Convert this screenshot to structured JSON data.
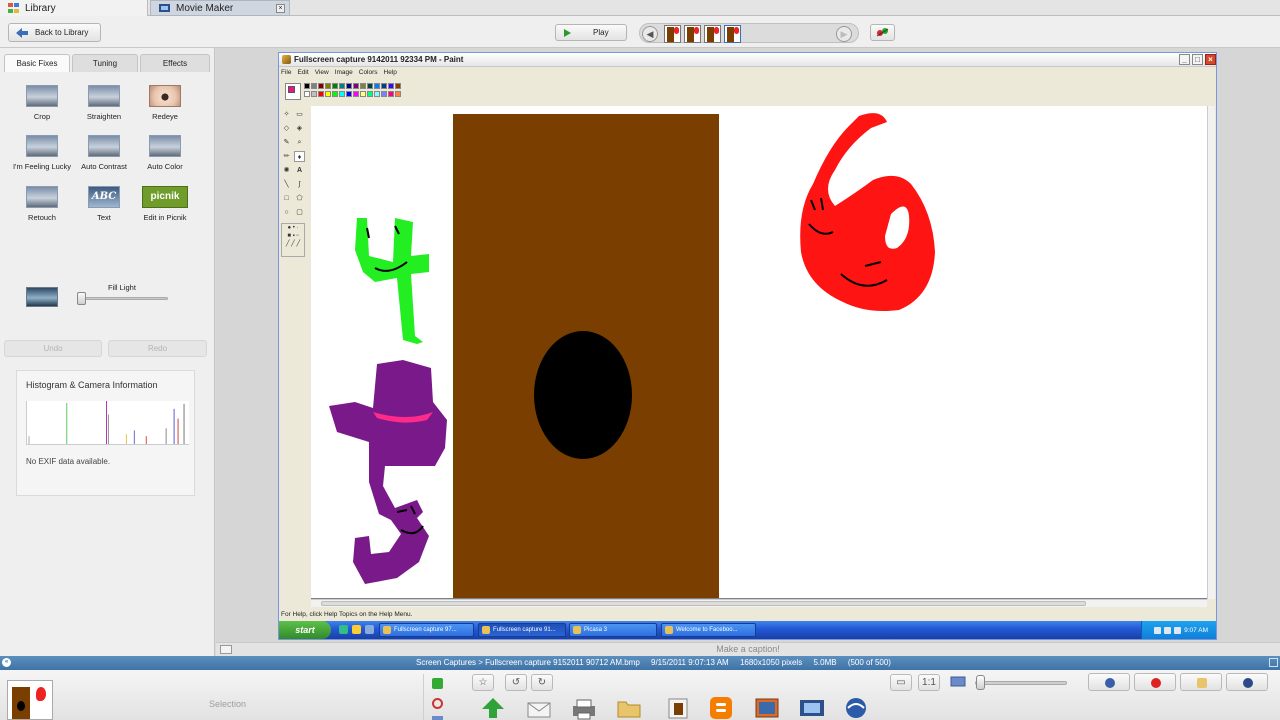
{
  "tabs": {
    "library": "Library",
    "movie_maker": "Movie Maker"
  },
  "toolbar": {
    "back_label": "Back to Library",
    "play_label": "Play"
  },
  "left_panel": {
    "tabs": [
      "Basic Fixes",
      "Tuning",
      "Effects"
    ],
    "fixes": [
      {
        "label": "Crop",
        "icon": "crop-icon"
      },
      {
        "label": "Straighten",
        "icon": "straighten-icon"
      },
      {
        "label": "Redeye",
        "icon": "redeye-icon"
      },
      {
        "label": "I'm Feeling Lucky",
        "icon": "feeling-lucky-icon"
      },
      {
        "label": "Auto Contrast",
        "icon": "auto-contrast-icon"
      },
      {
        "label": "Auto Color",
        "icon": "auto-color-icon"
      },
      {
        "label": "Retouch",
        "icon": "retouch-icon"
      },
      {
        "label": "Text",
        "icon": "text-icon"
      },
      {
        "label": "Edit in Picnik",
        "icon": "picnik-icon"
      }
    ],
    "fill_light_label": "Fill Light",
    "fill_light_value": 0,
    "undo_label": "Undo",
    "redo_label": "Redo",
    "histogram_title": "Histogram & Camera Information",
    "exif_text": "No EXIF data available.",
    "abc_glyph": "ABC",
    "picnik_glyph": "picnik"
  },
  "paint": {
    "title": "Fullscreen capture 9142011 92334 PM - Paint",
    "menus": [
      "File",
      "Edit",
      "View",
      "Image",
      "Colors",
      "Help"
    ],
    "status": "For Help, click Help Topics on the Help Menu.",
    "palette_colors": [
      "#000000",
      "#808080",
      "#800000",
      "#808000",
      "#008000",
      "#008080",
      "#000080",
      "#800080",
      "#808040",
      "#004040",
      "#0080ff",
      "#004080",
      "#4000ff",
      "#804000",
      "#ffffff",
      "#c0c0c0",
      "#ff0000",
      "#ffff00",
      "#00ff00",
      "#00ffff",
      "#0000ff",
      "#ff00ff",
      "#ffff80",
      "#00ff80",
      "#80ffff",
      "#8080ff",
      "#ff0080",
      "#ff8040"
    ],
    "current_color": "#e6168e",
    "taskbar": {
      "start_label": "start",
      "tasks": [
        "Fullscreen capture 97...",
        "Fullscreen capture 91...",
        "Picasa 3",
        "Welcome to Faceboo..."
      ],
      "active_task": 1,
      "clock": "9:07 AM"
    }
  },
  "caption_placeholder": "Make a caption!",
  "info": {
    "path": "Screen Captures > Fullscreen capture 9152011 90712 AM.bmp",
    "date": "9/15/2011 9:07:13 AM",
    "dimensions": "1680x1050 pixels",
    "size": "5.0MB",
    "position": "(500 of 500)"
  },
  "bottom": {
    "selection_label": "Selection"
  },
  "colors": {
    "accent_blue": "#3f73a5",
    "door_brown": "#7a3f00",
    "red_six": "#ff1414",
    "green_four": "#22ee22",
    "purple_five": "#7a1a8a"
  }
}
